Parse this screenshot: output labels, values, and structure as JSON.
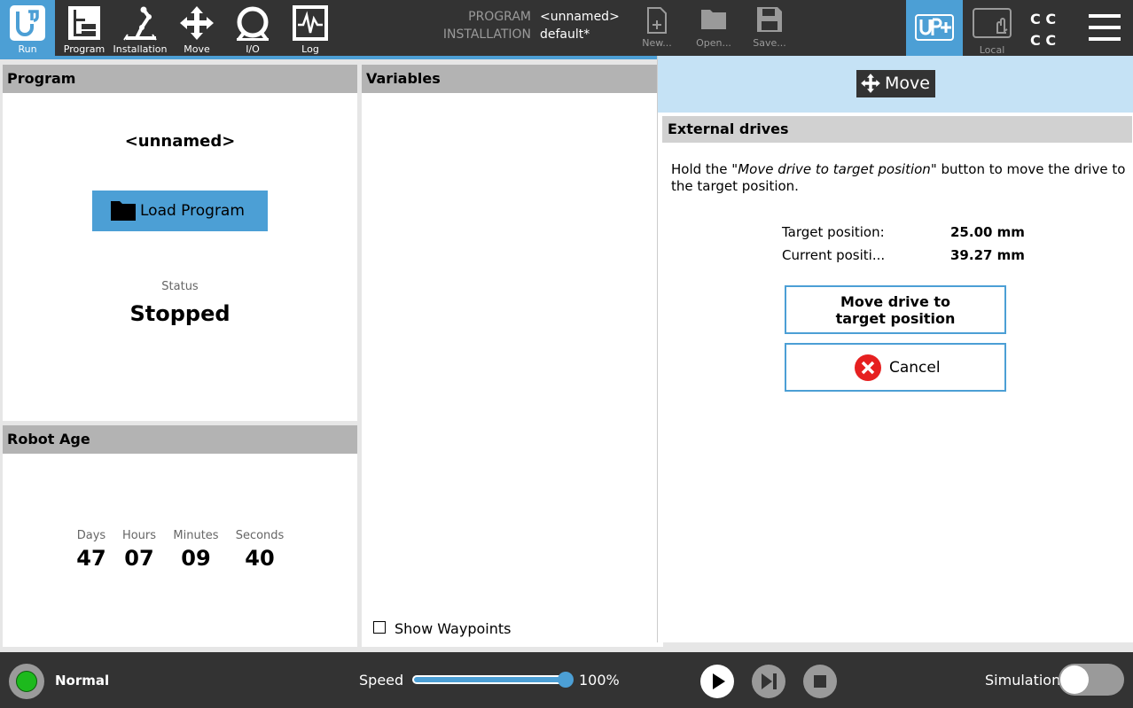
{
  "nav": {
    "items": [
      {
        "label": "Run",
        "icon": "ur-logo-icon"
      },
      {
        "label": "Program",
        "icon": "program-icon"
      },
      {
        "label": "Installation",
        "icon": "installation-icon"
      },
      {
        "label": "Move",
        "icon": "move-icon"
      },
      {
        "label": "I/O",
        "icon": "io-icon"
      },
      {
        "label": "Log",
        "icon": "log-icon"
      }
    ]
  },
  "header": {
    "program_key": "PROGRAM",
    "program_val": "<unnamed>",
    "installation_key": "INSTALLATION",
    "installation_val": "default*",
    "file_new": "New...",
    "file_open": "Open...",
    "file_save": "Save...",
    "local_label": "Local",
    "cc_label": "C C",
    "cc_label2": "C C"
  },
  "program_panel": {
    "title": "Program",
    "name": "<unnamed>",
    "load_label": "Load Program",
    "status_label": "Status",
    "status_value": "Stopped"
  },
  "robot_age": {
    "title": "Robot Age",
    "units": [
      {
        "label": "Days",
        "value": "47"
      },
      {
        "label": "Hours",
        "value": "07"
      },
      {
        "label": "Minutes",
        "value": "09"
      },
      {
        "label": "Seconds",
        "value": "40"
      }
    ]
  },
  "variables": {
    "title": "Variables",
    "show_waypoints": "Show Waypoints"
  },
  "move_dialog": {
    "move_label": "Move",
    "section_title": "External drives",
    "instr_a": "Hold the \"",
    "instr_em": "Move drive to target position",
    "instr_b": "\" button to move the drive to the target position.",
    "target_key": "Target position:",
    "target_val": "25.00 mm",
    "current_key": "Current positi...",
    "current_val": "39.27 mm",
    "move_btn_line1": "Move drive to",
    "move_btn_line2": "target position",
    "cancel_label": "Cancel"
  },
  "footer": {
    "status_text": "Normal",
    "status_color": "#1db91d",
    "speed_label": "Speed",
    "speed_value": "100%",
    "speed_fraction": 1.0,
    "simulation_label": "Simulation"
  },
  "colors": {
    "accent": "#4c9fd5",
    "topbar": "#333333",
    "dialog_head": "#c5e2f5"
  }
}
